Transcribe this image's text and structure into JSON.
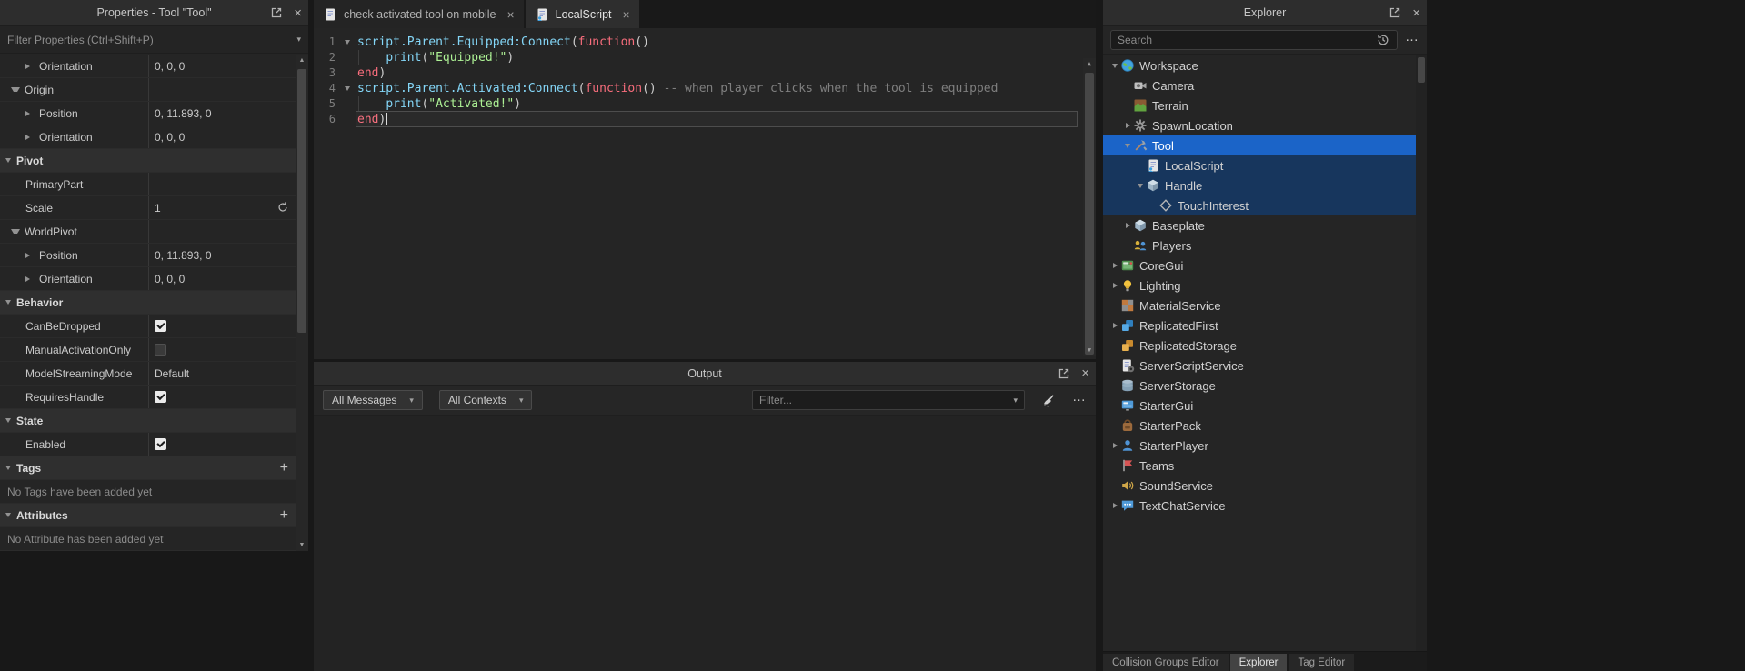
{
  "colors": {
    "selection": "#1b64c8",
    "descendant": "#17365d",
    "keyword": "#f86d7c",
    "string": "#adf195",
    "comment": "#7f7f7f",
    "builtin": "#84d6f7"
  },
  "properties": {
    "title": "Properties - Tool \"Tool\"",
    "filter_placeholder": "Filter Properties (Ctrl+Shift+P)",
    "rows": [
      {
        "kind": "property",
        "arrow": "right",
        "name": "Orientation",
        "value": "0, 0, 0"
      },
      {
        "kind": "group",
        "arrow": "down",
        "name": "Origin"
      },
      {
        "kind": "property",
        "arrow": "right",
        "name": "Position",
        "value": "0, 11.893, 0"
      },
      {
        "kind": "property",
        "arrow": "right",
        "name": "Orientation",
        "value": "0, 0, 0"
      },
      {
        "kind": "section",
        "name": "Pivot"
      },
      {
        "kind": "property",
        "name": "PrimaryPart",
        "value": ""
      },
      {
        "kind": "property",
        "name": "Scale",
        "value": "1",
        "reset": true
      },
      {
        "kind": "group",
        "arrow": "down",
        "name": "WorldPivot"
      },
      {
        "kind": "property",
        "arrow": "right",
        "name": "Position",
        "value": "0, 11.893, 0"
      },
      {
        "kind": "property",
        "arrow": "right",
        "name": "Orientation",
        "value": "0, 0, 0"
      },
      {
        "kind": "section",
        "name": "Behavior"
      },
      {
        "kind": "property",
        "name": "CanBeDropped",
        "checkbox": true,
        "checked": true
      },
      {
        "kind": "property",
        "name": "ManualActivationOnly",
        "checkbox": true,
        "checked": false
      },
      {
        "kind": "property",
        "name": "ModelStreamingMode",
        "value": "Default"
      },
      {
        "kind": "property",
        "name": "RequiresHandle",
        "checkbox": true,
        "checked": true
      },
      {
        "kind": "section",
        "name": "State"
      },
      {
        "kind": "property",
        "name": "Enabled",
        "checkbox": true,
        "checked": true
      },
      {
        "kind": "section",
        "name": "Tags",
        "add": true
      },
      {
        "kind": "note",
        "text": "No Tags have been added yet"
      },
      {
        "kind": "section",
        "name": "Attributes",
        "add": true
      },
      {
        "kind": "note",
        "text": "No Attribute has been added yet"
      }
    ]
  },
  "editor": {
    "tabs": [
      {
        "label": "check activated tool on mobile",
        "icon": "script",
        "active": false
      },
      {
        "label": "LocalScript",
        "icon": "localscript",
        "active": true
      }
    ],
    "lines": [
      {
        "n": 1,
        "fold": "down",
        "tokens": [
          [
            "script.Parent.Equipped:Connect",
            "builtin"
          ],
          [
            "(",
            "plain"
          ],
          [
            "function",
            "keyword"
          ],
          [
            "()",
            "plain"
          ]
        ]
      },
      {
        "n": 2,
        "guide": true,
        "tokens": [
          [
            "    ",
            "plain"
          ],
          [
            "print",
            "builtin"
          ],
          [
            "(",
            "plain"
          ],
          [
            "\"Equipped!\"",
            "string"
          ],
          [
            ")",
            "plain"
          ]
        ]
      },
      {
        "n": 3,
        "tokens": [
          [
            "end",
            "keyword"
          ],
          [
            ")",
            "plain"
          ]
        ]
      },
      {
        "n": 4,
        "fold": "down",
        "tokens": [
          [
            "script.Parent.Activated:Connect",
            "builtin"
          ],
          [
            "(",
            "plain"
          ],
          [
            "function",
            "keyword"
          ],
          [
            "()",
            "plain"
          ],
          [
            " ",
            "plain"
          ],
          [
            "-- when player clicks when the tool is equipped",
            "comment"
          ]
        ]
      },
      {
        "n": 5,
        "guide": true,
        "tokens": [
          [
            "    ",
            "plain"
          ],
          [
            "print",
            "builtin"
          ],
          [
            "(",
            "plain"
          ],
          [
            "\"Activated!\"",
            "string"
          ],
          [
            ")",
            "plain"
          ]
        ]
      },
      {
        "n": 6,
        "current": true,
        "tokens": [
          [
            "end",
            "keyword"
          ],
          [
            ")",
            "plain"
          ]
        ]
      }
    ]
  },
  "output": {
    "title": "Output",
    "messages_filter": "All Messages",
    "contexts_filter": "All Contexts",
    "filter_placeholder": "Filter..."
  },
  "explorer": {
    "title": "Explorer",
    "search_placeholder": "Search",
    "tree": [
      {
        "label": "Workspace",
        "icon": "workspace",
        "level": 0,
        "arrow": "down"
      },
      {
        "label": "Camera",
        "icon": "camera",
        "level": 1
      },
      {
        "label": "Terrain",
        "icon": "terrain",
        "level": 1
      },
      {
        "label": "SpawnLocation",
        "icon": "spawnlocation",
        "level": 1,
        "arrow": "right"
      },
      {
        "label": "Tool",
        "icon": "tool",
        "level": 1,
        "arrow": "down",
        "state": "selected"
      },
      {
        "label": "LocalScript",
        "icon": "localscript",
        "level": 2,
        "state": "descendant"
      },
      {
        "label": "Handle",
        "icon": "part",
        "level": 2,
        "arrow": "down",
        "state": "descendant"
      },
      {
        "label": "TouchInterest",
        "icon": "touchinterest",
        "level": 3,
        "state": "descendant"
      },
      {
        "label": "Baseplate",
        "icon": "part",
        "level": 1,
        "arrow": "right"
      },
      {
        "label": "Players",
        "icon": "players",
        "level": 1
      },
      {
        "label": "CoreGui",
        "icon": "coregui",
        "level": 0,
        "arrow": "right"
      },
      {
        "label": "Lighting",
        "icon": "lighting",
        "level": 0,
        "arrow": "right"
      },
      {
        "label": "MaterialService",
        "icon": "materialservice",
        "level": 0
      },
      {
        "label": "ReplicatedFirst",
        "icon": "replicatedfirst",
        "level": 0,
        "arrow": "right"
      },
      {
        "label": "ReplicatedStorage",
        "icon": "replicatedstorage",
        "level": 0
      },
      {
        "label": "ServerScriptService",
        "icon": "serverscriptservice",
        "level": 0
      },
      {
        "label": "ServerStorage",
        "icon": "serverstorage",
        "level": 0
      },
      {
        "label": "StarterGui",
        "icon": "startergui",
        "level": 0
      },
      {
        "label": "StarterPack",
        "icon": "starterpack",
        "level": 0
      },
      {
        "label": "StarterPlayer",
        "icon": "starterplayer",
        "level": 0,
        "arrow": "right"
      },
      {
        "label": "Teams",
        "icon": "teams",
        "level": 0
      },
      {
        "label": "SoundService",
        "icon": "soundservice",
        "level": 0
      },
      {
        "label": "TextChatService",
        "icon": "textchatservice",
        "level": 0,
        "arrow": "right"
      }
    ],
    "bottom_tabs": [
      {
        "label": "Collision Groups Editor",
        "active": false
      },
      {
        "label": "Explorer",
        "active": true
      },
      {
        "label": "Tag Editor",
        "active": false
      }
    ]
  }
}
